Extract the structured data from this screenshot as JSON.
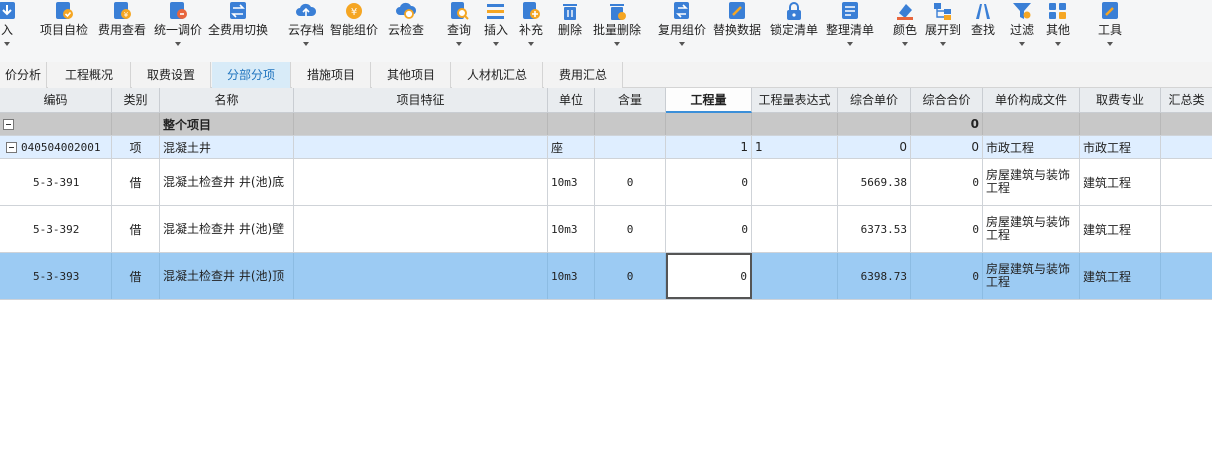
{
  "toolbar": {
    "buttons": [
      {
        "label": "入",
        "icon": "import-icon",
        "caret": true
      },
      {
        "label": "项目自检",
        "icon": "check-icon",
        "caret": false
      },
      {
        "label": "费用查看",
        "icon": "fee-view-icon",
        "caret": false
      },
      {
        "label": "统一调价",
        "icon": "adjust-price-icon",
        "caret": true
      },
      {
        "label": "全费用切换",
        "icon": "switch-icon",
        "caret": false
      },
      {
        "label": "云存档",
        "icon": "cloud-upload-icon",
        "caret": true
      },
      {
        "label": "智能组价",
        "icon": "smart-price-icon",
        "caret": false
      },
      {
        "label": "云检查",
        "icon": "cloud-check-icon",
        "caret": false
      },
      {
        "label": "查询",
        "icon": "query-icon",
        "caret": true
      },
      {
        "label": "插入",
        "icon": "insert-icon",
        "caret": true
      },
      {
        "label": "补充",
        "icon": "add-icon",
        "caret": true
      },
      {
        "label": "删除",
        "icon": "delete-icon",
        "caret": false
      },
      {
        "label": "批量删除",
        "icon": "batch-delete-icon",
        "caret": true
      },
      {
        "label": "复用组价",
        "icon": "reuse-icon",
        "caret": true
      },
      {
        "label": "替换数据",
        "icon": "replace-icon",
        "caret": false
      },
      {
        "label": "锁定清单",
        "icon": "lock-icon",
        "caret": false
      },
      {
        "label": "整理清单",
        "icon": "organize-icon",
        "caret": true
      },
      {
        "label": "颜色",
        "icon": "color-icon",
        "caret": true
      },
      {
        "label": "展开到",
        "icon": "expand-icon",
        "caret": true
      },
      {
        "label": "查找",
        "icon": "find-icon",
        "caret": false
      },
      {
        "label": "过滤",
        "icon": "filter-icon",
        "caret": true
      },
      {
        "label": "其他",
        "icon": "more-icon",
        "caret": true
      },
      {
        "label": "工具",
        "icon": "tools-icon",
        "caret": true
      }
    ]
  },
  "tabs": [
    {
      "label": "价分析",
      "active": false
    },
    {
      "label": "工程概况",
      "active": false
    },
    {
      "label": "取费设置",
      "active": false
    },
    {
      "label": "分部分项",
      "active": true
    },
    {
      "label": "措施项目",
      "active": false
    },
    {
      "label": "其他项目",
      "active": false
    },
    {
      "label": "人材机汇总",
      "active": false
    },
    {
      "label": "费用汇总",
      "active": false
    }
  ],
  "grid": {
    "headers": [
      "编码",
      "类别",
      "名称",
      "项目特征",
      "单位",
      "含量",
      "工程量",
      "工程量表达式",
      "综合单价",
      "综合合价",
      "单价构成文件",
      "取费专业",
      "汇总类"
    ],
    "total_row": {
      "name": "整个项目",
      "sum": "0"
    },
    "item_row": {
      "code": "040504002001",
      "type": "项",
      "name": "混凝土井",
      "unit": "座",
      "quantity": "1",
      "expr": "1",
      "unit_price": "0",
      "total": "0",
      "price_file": "市政工程",
      "fee_major": "市政工程"
    },
    "child_rows": [
      {
        "code": "5-3-391",
        "type": "借",
        "name": "混凝土检查井 井(池)底",
        "unit": "10m3",
        "content": "0",
        "quantity": "0",
        "unit_price": "5669.38",
        "total": "0",
        "price_file": "房屋建筑与装饰工程",
        "fee_major": "建筑工程"
      },
      {
        "code": "5-3-392",
        "type": "借",
        "name": "混凝土检查井 井(池)壁",
        "unit": "10m3",
        "content": "0",
        "quantity": "0",
        "unit_price": "6373.53",
        "total": "0",
        "price_file": "房屋建筑与装饰工程",
        "fee_major": "建筑工程"
      },
      {
        "code": "5-3-393",
        "type": "借",
        "name": "混凝土检查井 井(池)顶",
        "unit": "10m3",
        "content": "0",
        "quantity": "0",
        "unit_price": "6398.73",
        "total": "0",
        "price_file": "房屋建筑与装饰工程",
        "fee_major": "建筑工程"
      }
    ]
  },
  "colors": {
    "accent": "#1e73be",
    "selected_row": "#9ccbf3",
    "item_row": "#dfeeff",
    "total_row": "#c8c8c8"
  }
}
